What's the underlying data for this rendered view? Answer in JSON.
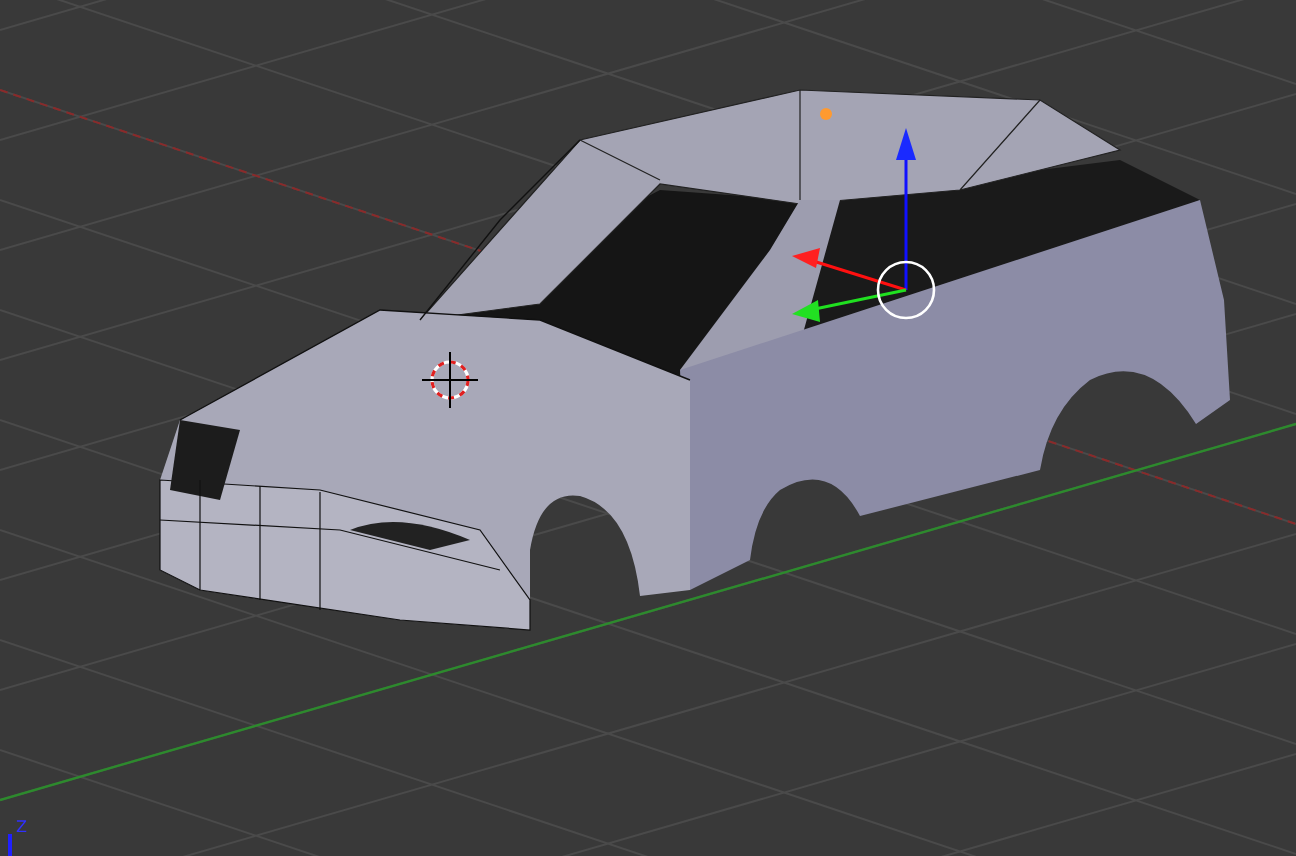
{
  "viewport": {
    "axis_label": "Z"
  }
}
